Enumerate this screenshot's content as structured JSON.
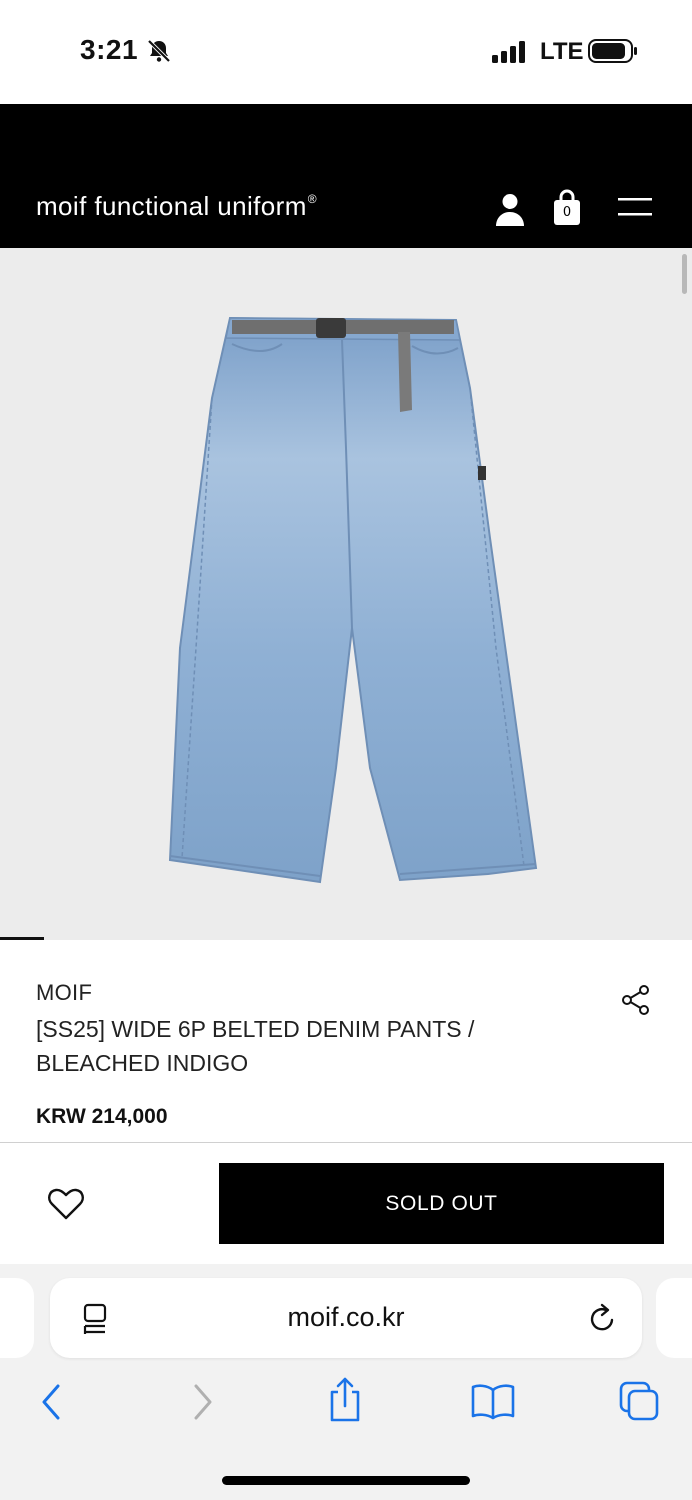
{
  "status_bar": {
    "time": "3:21",
    "network": "LTE"
  },
  "header": {
    "logo": "moif functional uniform",
    "logo_mark": "®",
    "cart_count": "0"
  },
  "product": {
    "brand": "MOIF",
    "title": "[SS25] WIDE 6P BELTED DENIM PANTS / BLEACHED INDIGO",
    "price": "KRW 214,000",
    "image_icon": "denim-pants-photo"
  },
  "actions": {
    "sold_out_label": "SOLD OUT"
  },
  "browser": {
    "url": "moif.co.kr"
  },
  "colors": {
    "header_bg": "#000000",
    "accent": "#000000",
    "link_blue": "#1a73e8",
    "gallery_bg": "#ececec"
  }
}
